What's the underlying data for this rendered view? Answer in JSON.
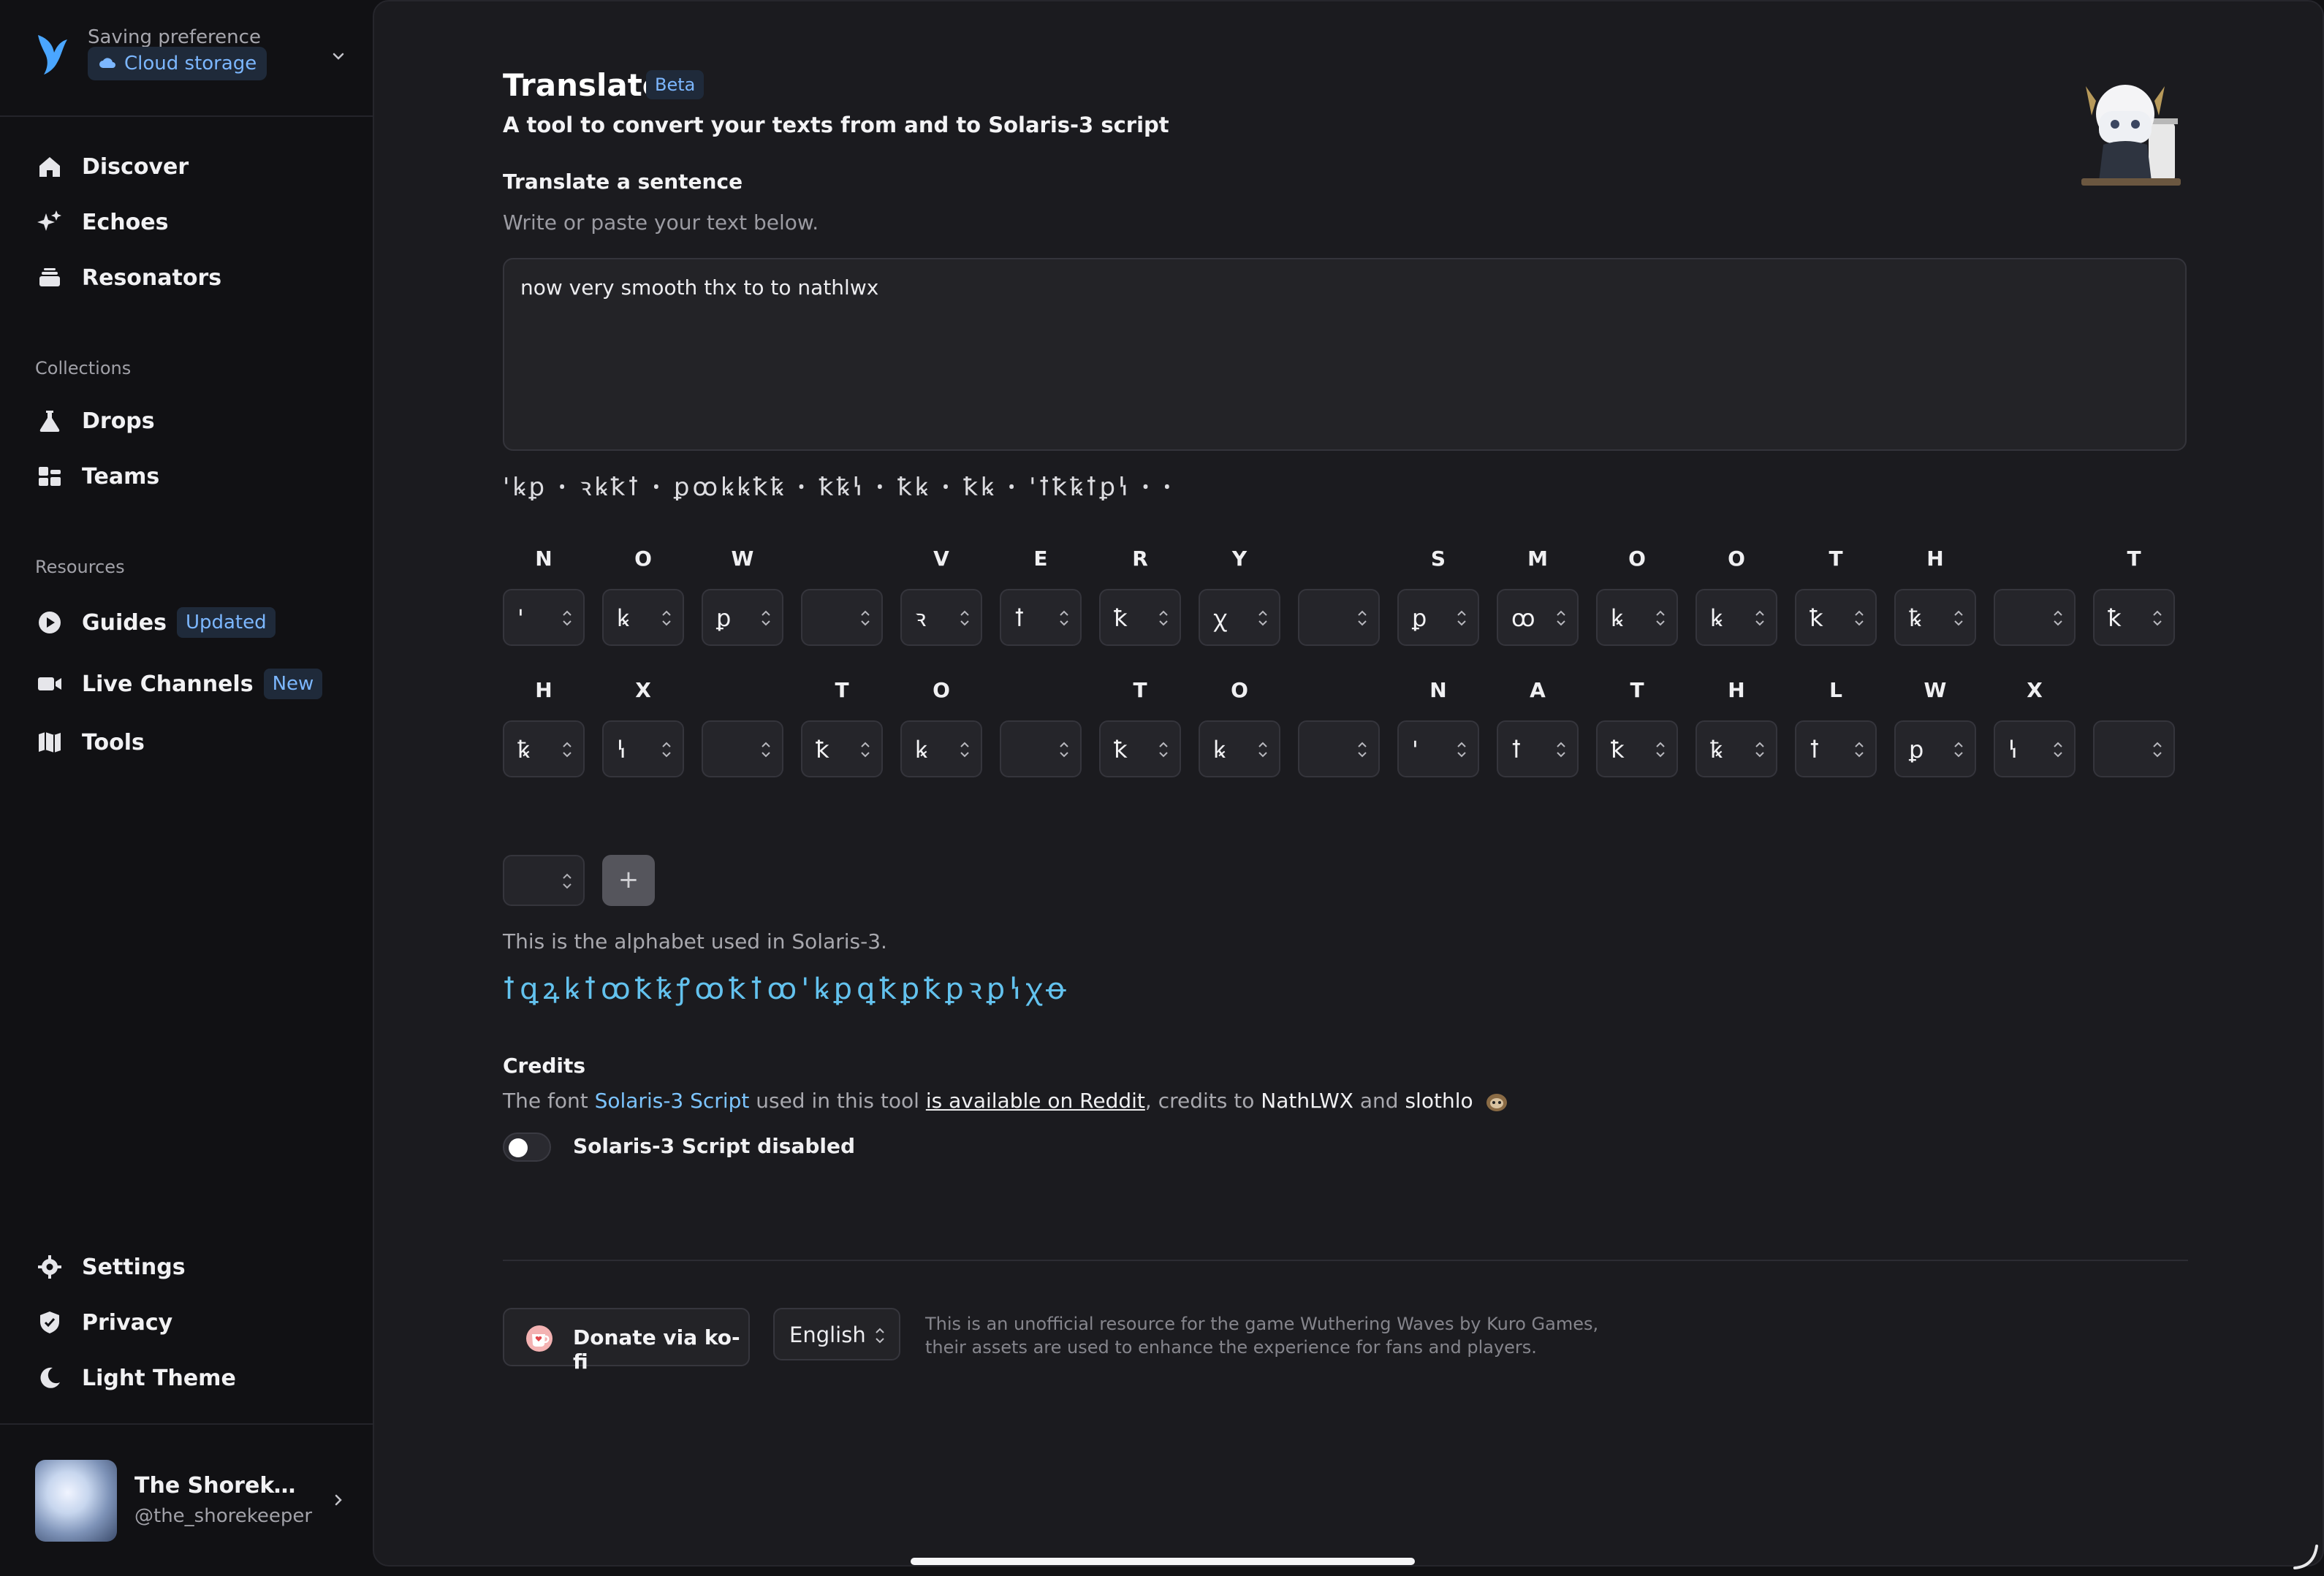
{
  "sidebar": {
    "preference_label": "Saving preference",
    "preference_value": "Cloud storage",
    "nav_main": [
      {
        "label": "Discover",
        "icon": "home-icon"
      },
      {
        "label": "Echoes",
        "icon": "sparkles-icon"
      },
      {
        "label": "Resonators",
        "icon": "stack-icon"
      }
    ],
    "collections_title": "Collections",
    "collections": [
      {
        "label": "Drops",
        "icon": "flask-icon"
      },
      {
        "label": "Teams",
        "icon": "grid-icon"
      }
    ],
    "resources_title": "Resources",
    "resources": [
      {
        "label": "Guides",
        "icon": "play-circle-icon",
        "tag": "Updated"
      },
      {
        "label": "Live Channels",
        "icon": "video-icon",
        "tag": "New"
      },
      {
        "label": "Tools",
        "icon": "map-icon"
      }
    ],
    "bottom": [
      {
        "label": "Settings",
        "icon": "gear-icon"
      },
      {
        "label": "Privacy",
        "icon": "shield-icon"
      },
      {
        "label": "Light Theme",
        "icon": "moon-icon"
      }
    ],
    "user": {
      "name": "The Shorekee...",
      "handle": "@the_shorekeeper"
    }
  },
  "main": {
    "title": "Translate",
    "beta_tag": "Beta",
    "subtitle": "A tool to convert your texts from and to Solaris-3 script",
    "translate_heading": "Translate a sentence",
    "translate_hint": "Write or paste your text below.",
    "input_text": "now very smooth thx to to nathlwx",
    "script_output": "ꞌꝃꝑ ꞏ ꝛꝃꝁꝉ ꞏ ꝑꝏꝃꝃꝁꝅ ꞏ ꝁꝅꝇ ꞏ ꝁꝃ ꞏ ꝁꝃ ꞏ ꞌꝉꝁꝅꝉꝑꝇ ꞏ ꞏ",
    "letters_row1": [
      {
        "label": "N",
        "glyph": "ꞌ"
      },
      {
        "label": "O",
        "glyph": "ꝃ"
      },
      {
        "label": "W",
        "glyph": "ꝑ"
      },
      {
        "label": "",
        "glyph": ""
      },
      {
        "label": "V",
        "glyph": "ꝛ"
      },
      {
        "label": "E",
        "glyph": "ꝉ"
      },
      {
        "label": "R",
        "glyph": "ꝁ"
      },
      {
        "label": "Y",
        "glyph": "ꭓ"
      },
      {
        "label": "",
        "glyph": ""
      },
      {
        "label": "S",
        "glyph": "ꝑ"
      },
      {
        "label": "M",
        "glyph": "ꝏ"
      },
      {
        "label": "O",
        "glyph": "ꝃ"
      },
      {
        "label": "O",
        "glyph": "ꝃ"
      },
      {
        "label": "T",
        "glyph": "ꝁ"
      },
      {
        "label": "H",
        "glyph": "ꝅ"
      },
      {
        "label": "",
        "glyph": ""
      },
      {
        "label": "T",
        "glyph": "ꝁ"
      }
    ],
    "letters_row2": [
      {
        "label": "H",
        "glyph": "ꝅ"
      },
      {
        "label": "X",
        "glyph": "ꝇ"
      },
      {
        "label": "",
        "glyph": ""
      },
      {
        "label": "T",
        "glyph": "ꝁ"
      },
      {
        "label": "O",
        "glyph": "ꝃ"
      },
      {
        "label": "",
        "glyph": ""
      },
      {
        "label": "T",
        "glyph": "ꝁ"
      },
      {
        "label": "O",
        "glyph": "ꝃ"
      },
      {
        "label": "",
        "glyph": ""
      },
      {
        "label": "N",
        "glyph": "ꞌ"
      },
      {
        "label": "A",
        "glyph": "ꝉ"
      },
      {
        "label": "T",
        "glyph": "ꝁ"
      },
      {
        "label": "H",
        "glyph": "ꝅ"
      },
      {
        "label": "L",
        "glyph": "ꝉ"
      },
      {
        "label": "W",
        "glyph": "ꝑ"
      },
      {
        "label": "X",
        "glyph": "ꝇ"
      },
      {
        "label": "",
        "glyph": ""
      }
    ],
    "add_button": "+",
    "alphabet_note": "This is the alphabet used in Solaris-3.",
    "alphabet": "ꝉꝗꝝꝃꝉꝏꝁꝅꝭꝏꝁꝉꝏꞌꝃꝑꝗꝁꝑꝁꝑꝛꝑꝇꭓꝋ",
    "credits_title": "Credits",
    "credits": {
      "prefix": "The font ",
      "font_link": "Solaris-3 Script",
      "middle": " used in this tool ",
      "reddit_link": "is available on Reddit",
      "after_link": ", credits to ",
      "author1": "NathLWX",
      "and": " and ",
      "author2": "slothlo"
    },
    "toggle_label": "Solaris-3 Script disabled",
    "toggle_on": false,
    "donate_label": "Donate via ko-fi",
    "language": "English",
    "disclaimer": "This is an unofficial resource for the game Wuthering Waves by Kuro Games, their assets are used to enhance the experience for fans and players."
  },
  "colors": {
    "accent": "#7cb7ff",
    "alphabet": "#63c2ee",
    "background": "#1b1b1f",
    "sidebar": "#111114"
  }
}
